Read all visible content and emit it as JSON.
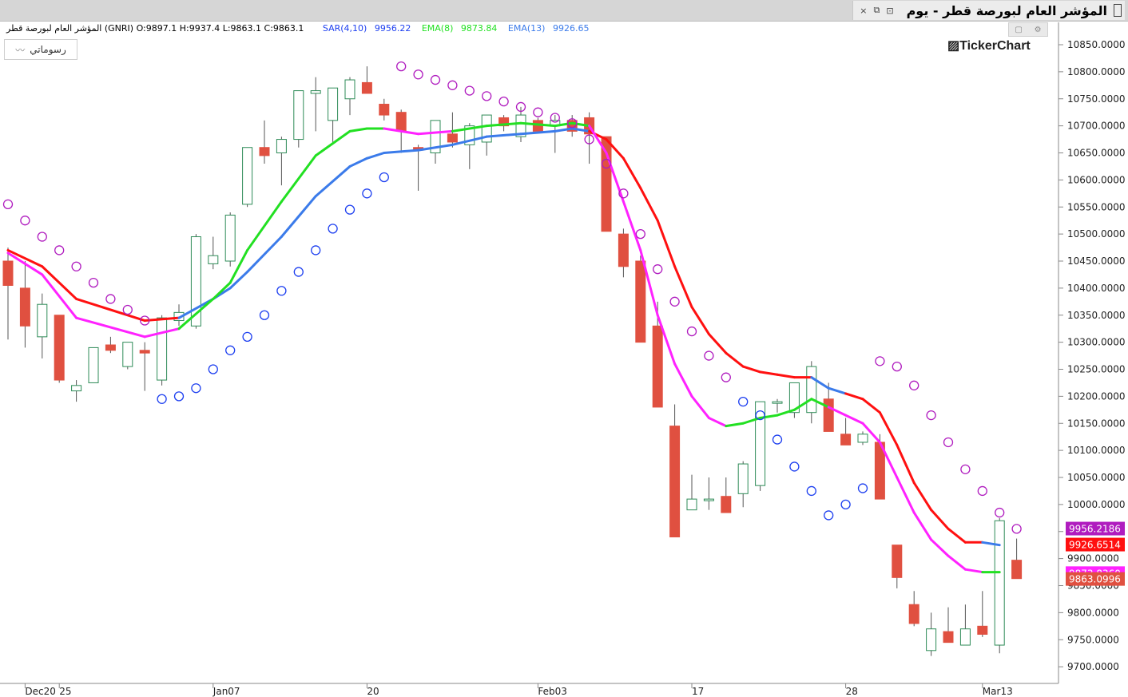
{
  "window": {
    "title": "المؤشر العام لبورصة قطر - يوم",
    "close_label": "×",
    "restore_label": "⧉",
    "detach_label": "⊡"
  },
  "legend": {
    "ohlc": "المؤشر العام لبورصة قطر (GNRI)  O:9897.1  H:9937.4  L:9863.1  C:9863.1",
    "sar_label": "SAR(4,10)",
    "sar_value": "9956.22",
    "ema8_label": "EMA(8)",
    "ema8_value": "9873.84",
    "ema13_label": "EMA(13)",
    "ema13_value": "9926.65"
  },
  "toolbar": {
    "drawing_label": "رسوماتي",
    "drawing_icon": "line-chart-icon"
  },
  "brand": "TickerChart",
  "colors": {
    "up": "#2e8b57",
    "down": "#e05040",
    "sar_up": "#1d3ff0",
    "sar_down": "#b01cbf",
    "ema8_up": "#22e022",
    "ema8_down": "#ff22ff",
    "ema13_up": "#3b7bea",
    "ema13_down": "#ff1010"
  },
  "chart_data": {
    "type": "candlestick",
    "yaxis_ticks": [
      10850,
      10800,
      10750,
      10700,
      10650,
      10600,
      10550,
      10500,
      10450,
      10400,
      10350,
      10300,
      10250,
      10200,
      10150,
      10100,
      10050,
      10000,
      9950,
      9900,
      9850,
      9800,
      9750,
      9700
    ],
    "yaxis_tick_labels": [
      "10850.0000",
      "10800.0000",
      "10750.0000",
      "10700.0000",
      "10650.0000",
      "10600.0000",
      "10550.0000",
      "10500.0000",
      "10450.0000",
      "10400.0000",
      "10350.0000",
      "10300.0000",
      "10250.0000",
      "10200.0000",
      "10150.0000",
      "10100.0000",
      "10050.0000",
      "10000.0000",
      "9950.0000",
      "9900.0000",
      "9850.0000",
      "9800.0000",
      "9750.0000",
      "9700.0000"
    ],
    "ylim": [
      9670,
      10870
    ],
    "xaxis_labels": [
      {
        "index": 1,
        "label": "Dec20"
      },
      {
        "index": 3,
        "label": "25"
      },
      {
        "index": 12,
        "label": "Jan07"
      },
      {
        "index": 21,
        "label": "20"
      },
      {
        "index": 31,
        "label": "Feb03"
      },
      {
        "index": 40,
        "label": "17"
      },
      {
        "index": 49,
        "label": "28"
      },
      {
        "index": 57,
        "label": "Mar13"
      }
    ],
    "candles": [
      {
        "o": 10450,
        "h": 10475,
        "l": 10305,
        "c": 10405
      },
      {
        "o": 10400,
        "h": 10450,
        "l": 10290,
        "c": 10330
      },
      {
        "o": 10310,
        "h": 10390,
        "l": 10270,
        "c": 10370
      },
      {
        "o": 10350,
        "h": 10350,
        "l": 10225,
        "c": 10230
      },
      {
        "o": 10210,
        "h": 10230,
        "l": 10190,
        "c": 10220
      },
      {
        "o": 10225,
        "h": 10290,
        "l": 10225,
        "c": 10290
      },
      {
        "o": 10295,
        "h": 10310,
        "l": 10280,
        "c": 10285
      },
      {
        "o": 10255,
        "h": 10300,
        "l": 10250,
        "c": 10300
      },
      {
        "o": 10285,
        "h": 10300,
        "l": 10210,
        "c": 10280
      },
      {
        "o": 10230,
        "h": 10350,
        "l": 10220,
        "c": 10345
      },
      {
        "o": 10340,
        "h": 10370,
        "l": 10330,
        "c": 10355
      },
      {
        "o": 10330,
        "h": 10500,
        "l": 10325,
        "c": 10495
      },
      {
        "o": 10445,
        "h": 10495,
        "l": 10435,
        "c": 10460
      },
      {
        "o": 10450,
        "h": 10540,
        "l": 10440,
        "c": 10535
      },
      {
        "o": 10555,
        "h": 10660,
        "l": 10550,
        "c": 10660
      },
      {
        "o": 10660,
        "h": 10710,
        "l": 10630,
        "c": 10645
      },
      {
        "o": 10650,
        "h": 10680,
        "l": 10590,
        "c": 10675
      },
      {
        "o": 10675,
        "h": 10765,
        "l": 10660,
        "c": 10765
      },
      {
        "o": 10760,
        "h": 10790,
        "l": 10690,
        "c": 10765
      },
      {
        "o": 10710,
        "h": 10770,
        "l": 10670,
        "c": 10770
      },
      {
        "o": 10750,
        "h": 10790,
        "l": 10720,
        "c": 10785
      },
      {
        "o": 10780,
        "h": 10810,
        "l": 10760,
        "c": 10760
      },
      {
        "o": 10740,
        "h": 10750,
        "l": 10710,
        "c": 10720
      },
      {
        "o": 10725,
        "h": 10730,
        "l": 10650,
        "c": 10690
      },
      {
        "o": 10660,
        "h": 10665,
        "l": 10580,
        "c": 10655
      },
      {
        "o": 10650,
        "h": 10710,
        "l": 10630,
        "c": 10710
      },
      {
        "o": 10685,
        "h": 10725,
        "l": 10660,
        "c": 10670
      },
      {
        "o": 10665,
        "h": 10705,
        "l": 10620,
        "c": 10700
      },
      {
        "o": 10670,
        "h": 10720,
        "l": 10645,
        "c": 10720
      },
      {
        "o": 10715,
        "h": 10720,
        "l": 10690,
        "c": 10700
      },
      {
        "o": 10680,
        "h": 10735,
        "l": 10670,
        "c": 10720
      },
      {
        "o": 10710,
        "h": 10715,
        "l": 10690,
        "c": 10690
      },
      {
        "o": 10700,
        "h": 10720,
        "l": 10650,
        "c": 10710
      },
      {
        "o": 10710,
        "h": 10720,
        "l": 10680,
        "c": 10690
      },
      {
        "o": 10715,
        "h": 10725,
        "l": 10630,
        "c": 10685
      },
      {
        "o": 10680,
        "h": 10680,
        "l": 10505,
        "c": 10505
      },
      {
        "o": 10500,
        "h": 10510,
        "l": 10420,
        "c": 10440
      },
      {
        "o": 10450,
        "h": 10460,
        "l": 10300,
        "c": 10300
      },
      {
        "o": 10330,
        "h": 10375,
        "l": 10180,
        "c": 10180
      },
      {
        "o": 10145,
        "h": 10185,
        "l": 9940,
        "c": 9940
      },
      {
        "o": 9990,
        "h": 10055,
        "l": 9990,
        "c": 10010
      },
      {
        "o": 10010,
        "h": 10050,
        "l": 9990,
        "c": 10010
      },
      {
        "o": 10015,
        "h": 10050,
        "l": 9985,
        "c": 9985
      },
      {
        "o": 10020,
        "h": 10080,
        "l": 9995,
        "c": 10075
      },
      {
        "o": 10035,
        "h": 10190,
        "l": 10025,
        "c": 10190
      },
      {
        "o": 10190,
        "h": 10195,
        "l": 10170,
        "c": 10190
      },
      {
        "o": 10170,
        "h": 10225,
        "l": 10160,
        "c": 10225
      },
      {
        "o": 10170,
        "h": 10265,
        "l": 10150,
        "c": 10255
      },
      {
        "o": 10195,
        "h": 10225,
        "l": 10140,
        "c": 10135
      },
      {
        "o": 10130,
        "h": 10160,
        "l": 10110,
        "c": 10110
      },
      {
        "o": 10115,
        "h": 10135,
        "l": 10110,
        "c": 10130
      },
      {
        "o": 10115,
        "h": 10130,
        "l": 10010,
        "c": 10010
      },
      {
        "o": 9925,
        "h": 9925,
        "l": 9845,
        "c": 9865
      },
      {
        "o": 9815,
        "h": 9840,
        "l": 9775,
        "c": 9780
      },
      {
        "o": 9730,
        "h": 9800,
        "l": 9720,
        "c": 9770
      },
      {
        "o": 9765,
        "h": 9810,
        "l": 9745,
        "c": 9745
      },
      {
        "o": 9740,
        "h": 9815,
        "l": 9740,
        "c": 9770
      },
      {
        "o": 9775,
        "h": 9840,
        "l": 9755,
        "c": 9760
      },
      {
        "o": 9740,
        "h": 9975,
        "l": 9725,
        "c": 9970
      },
      {
        "o": 9897,
        "h": 9937,
        "l": 9863,
        "c": 9863
      }
    ],
    "series": [
      {
        "name": "SAR(4,10)",
        "type": "dots",
        "values": [
          10555,
          10525,
          10495,
          10470,
          10440,
          10410,
          10380,
          10360,
          10340,
          10195,
          10200,
          10215,
          10250,
          10285,
          10310,
          10350,
          10395,
          10430,
          10470,
          10510,
          10545,
          10575,
          10605,
          10810,
          10795,
          10785,
          10775,
          10765,
          10755,
          10745,
          10735,
          10725,
          10715,
          10705,
          10675,
          10630,
          10575,
          10500,
          10435,
          10375,
          10320,
          10275,
          10235,
          10190,
          10165,
          10120,
          10070,
          10025,
          9980,
          10000,
          10030,
          10265,
          10255,
          10220,
          10165,
          10115,
          10065,
          10025,
          9985,
          9955
        ],
        "colors": [
          "down",
          "down",
          "down",
          "down",
          "down",
          "down",
          "down",
          "down",
          "down",
          "up",
          "up",
          "up",
          "up",
          "up",
          "up",
          "up",
          "up",
          "up",
          "up",
          "up",
          "up",
          "up",
          "up",
          "down",
          "down",
          "down",
          "down",
          "down",
          "down",
          "down",
          "down",
          "down",
          "down",
          "down",
          "down",
          "down",
          "down",
          "down",
          "down",
          "down",
          "down",
          "down",
          "down",
          "up",
          "up",
          "up",
          "up",
          "up",
          "up",
          "up",
          "up",
          "down",
          "down",
          "down",
          "down",
          "down",
          "down",
          "down",
          "down",
          "down"
        ]
      },
      {
        "name": "EMA(8)",
        "type": "line",
        "values": [
          10465,
          10425,
          10390,
          10345,
          10320,
          10310,
          10340,
          10375,
          10420,
          10480,
          10530,
          10565,
          10620,
          10665,
          10685,
          10695,
          10695,
          10690,
          10685,
          10690,
          10695,
          10700,
          10705,
          10705,
          10700,
          10705,
          10700,
          10600,
          10490,
          10400,
          10330,
          10290,
          10255,
          10210,
          10165,
          10145,
          10155,
          10175,
          10200,
          10180,
          10145,
          10110,
          10075,
          10000,
          9940,
          9925,
          9905,
          9935,
          9875,
          9875
        ],
        "offset": 0
      },
      {
        "name": "EMA(13)",
        "type": "line",
        "values": [
          10470,
          10440,
          10400,
          10375,
          10355,
          10340,
          10345,
          10345,
          10375,
          10400,
          10430,
          10470,
          10505,
          10545,
          10580,
          10610,
          10635,
          10645,
          10655,
          10665,
          10670,
          10675,
          10680,
          10690,
          10695,
          10700,
          10700,
          10690,
          10655,
          10610,
          10545,
          10470,
          10380,
          10320,
          10285,
          10255,
          10245,
          10240,
          10235,
          10235,
          10225,
          10205,
          10185,
          10160,
          10110,
          10040,
          9990,
          9940,
          9925,
          9915
        ],
        "offset": 0
      }
    ],
    "ema8_points": [
      [
        0,
        10465
      ],
      [
        2,
        10425
      ],
      [
        4,
        10345
      ],
      [
        8,
        10310
      ],
      [
        10,
        10325
      ],
      [
        12,
        10380
      ],
      [
        13,
        10410
      ],
      [
        14,
        10470
      ],
      [
        16,
        10560
      ],
      [
        18,
        10645
      ],
      [
        20,
        10690
      ],
      [
        21,
        10695
      ],
      [
        22,
        10695
      ],
      [
        23,
        10690
      ],
      [
        24,
        10685
      ],
      [
        26,
        10690
      ],
      [
        28,
        10700
      ],
      [
        30,
        10705
      ],
      [
        32,
        10700
      ],
      [
        33,
        10705
      ],
      [
        34,
        10700
      ],
      [
        35,
        10650
      ],
      [
        36,
        10560
      ],
      [
        37,
        10470
      ],
      [
        38,
        10350
      ],
      [
        39,
        10260
      ],
      [
        40,
        10200
      ],
      [
        41,
        10160
      ],
      [
        42,
        10145
      ],
      [
        43,
        10150
      ],
      [
        44,
        10160
      ],
      [
        45,
        10165
      ],
      [
        46,
        10175
      ],
      [
        47,
        10195
      ],
      [
        48,
        10180
      ],
      [
        49,
        10165
      ],
      [
        50,
        10150
      ],
      [
        51,
        10115
      ],
      [
        52,
        10050
      ],
      [
        53,
        9985
      ],
      [
        54,
        9935
      ],
      [
        55,
        9905
      ],
      [
        56,
        9880
      ],
      [
        57,
        9875
      ],
      [
        58,
        9875
      ]
    ],
    "ema8_colors": [
      "down",
      "down",
      "down",
      "down",
      "up",
      "up",
      "up",
      "up",
      "up",
      "up",
      "up",
      "up",
      "down",
      "down",
      "down",
      "up",
      "up",
      "up",
      "up",
      "up",
      "down",
      "down",
      "down",
      "down",
      "down",
      "down",
      "down",
      "down",
      "up",
      "up",
      "up",
      "up",
      "up",
      "up",
      "down",
      "down",
      "down",
      "down",
      "down",
      "down",
      "down",
      "down",
      "down",
      "up",
      "up"
    ],
    "ema13_points": [
      [
        0,
        10470
      ],
      [
        2,
        10440
      ],
      [
        4,
        10380
      ],
      [
        8,
        10340
      ],
      [
        10,
        10345
      ],
      [
        12,
        10380
      ],
      [
        13,
        10400
      ],
      [
        14,
        10430
      ],
      [
        16,
        10495
      ],
      [
        18,
        10570
      ],
      [
        20,
        10625
      ],
      [
        21,
        10640
      ],
      [
        22,
        10650
      ],
      [
        24,
        10655
      ],
      [
        26,
        10665
      ],
      [
        28,
        10680
      ],
      [
        30,
        10685
      ],
      [
        32,
        10690
      ],
      [
        33,
        10695
      ],
      [
        34,
        10690
      ],
      [
        35,
        10675
      ],
      [
        36,
        10640
      ],
      [
        37,
        10585
      ],
      [
        38,
        10525
      ],
      [
        39,
        10440
      ],
      [
        40,
        10365
      ],
      [
        41,
        10315
      ],
      [
        42,
        10280
      ],
      [
        43,
        10255
      ],
      [
        44,
        10245
      ],
      [
        45,
        10240
      ],
      [
        46,
        10235
      ],
      [
        47,
        10235
      ],
      [
        48,
        10215
      ],
      [
        49,
        10205
      ],
      [
        50,
        10195
      ],
      [
        51,
        10170
      ],
      [
        52,
        10110
      ],
      [
        53,
        10040
      ],
      [
        54,
        9990
      ],
      [
        55,
        9955
      ],
      [
        56,
        9930
      ],
      [
        57,
        9930
      ],
      [
        58,
        9925
      ]
    ],
    "ema13_colors": [
      "down",
      "down",
      "down",
      "down",
      "up",
      "up",
      "up",
      "up",
      "up",
      "up",
      "up",
      "up",
      "up",
      "up",
      "up",
      "up",
      "up",
      "up",
      "up",
      "down",
      "down",
      "down",
      "down",
      "down",
      "down",
      "down",
      "down",
      "down",
      "down",
      "down",
      "down",
      "down",
      "up",
      "up",
      "down",
      "down",
      "down",
      "down",
      "down",
      "down",
      "down",
      "down",
      "up",
      "up",
      "down"
    ],
    "price_tags": [
      {
        "label": "9956.2186",
        "value": 9956.2186,
        "color": "#b01cbf"
      },
      {
        "label": "9926.6514",
        "value": 9926.6514,
        "color": "#ff1010"
      },
      {
        "label": "9873.8360",
        "value": 9873.836,
        "color": "#ff22ff"
      },
      {
        "label": "9863.0996",
        "value": 9863.0996,
        "color": "#e05040"
      }
    ]
  }
}
